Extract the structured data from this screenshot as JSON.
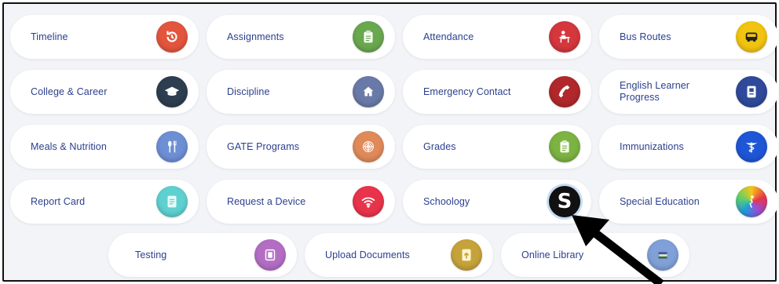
{
  "tiles": {
    "timeline": {
      "label": "Timeline",
      "icon": "timeline-icon",
      "color": "#e4553d"
    },
    "assignments": {
      "label": "Assignments",
      "icon": "clipboard-icon",
      "color": "#6aa84f"
    },
    "attendance": {
      "label": "Attendance",
      "icon": "student-desk-icon",
      "color": "#d4373c"
    },
    "bus_routes": {
      "label": "Bus Routes",
      "icon": "bus-icon",
      "color": "#f1c40f"
    },
    "college_career": {
      "label": "College & Career",
      "icon": "graduation-cap-icon",
      "color": "#2d3e50"
    },
    "discipline": {
      "label": "Discipline",
      "icon": "home-icon",
      "color": "#6a7aa8"
    },
    "emergency_contact": {
      "label": "Emergency Contact",
      "icon": "phone-icon",
      "color": "#b0282b"
    },
    "english_learner": {
      "label": "English Learner Progress",
      "icon": "book-icon",
      "color": "#2f4a9a"
    },
    "meals": {
      "label": "Meals & Nutrition",
      "icon": "utensils-icon",
      "color": "#6d8fd4"
    },
    "gate": {
      "label": "GATE Programs",
      "icon": "brain-icon",
      "color": "#e08a5a"
    },
    "grades": {
      "label": "Grades",
      "icon": "clipboard-icon",
      "color": "#7cb342"
    },
    "immunizations": {
      "label": "Immunizations",
      "icon": "caduceus-icon",
      "color": "#1e56d6"
    },
    "report_card": {
      "label": "Report Card",
      "icon": "document-icon",
      "color": "#5fd0d0"
    },
    "request_device": {
      "label": "Request a Device",
      "icon": "wifi-icon",
      "color": "#e8344a"
    },
    "schoology": {
      "label": "Schoology",
      "icon": "schoology-s-icon",
      "color": "#111111",
      "glyph": "S"
    },
    "special_ed": {
      "label": "Special Education",
      "icon": "person-icon",
      "color": "#9b4fd6"
    },
    "testing": {
      "label": "Testing",
      "icon": "tablet-icon",
      "color": "#b36ec4"
    },
    "upload_docs": {
      "label": "Upload Documents",
      "icon": "upload-icon",
      "color": "#c6a33a"
    },
    "online_library": {
      "label": "Online Library",
      "icon": "books-icon",
      "color": "#7fa0d8"
    }
  }
}
